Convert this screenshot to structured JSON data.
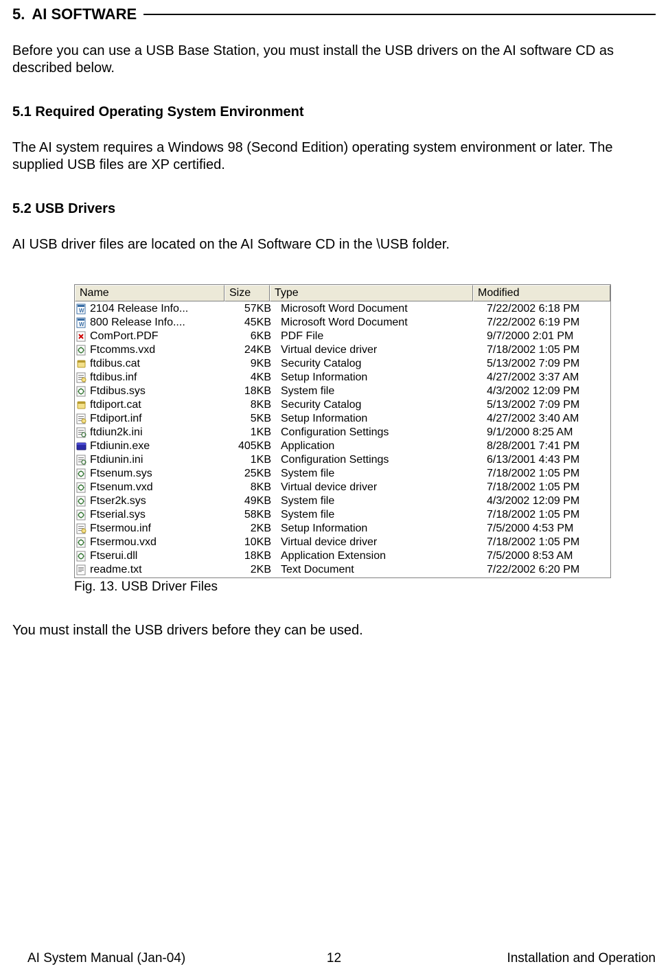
{
  "section": {
    "number": "5.",
    "title": "AI SOFTWARE",
    "intro": "Before you can use a USB Base Station, you must install the USB drivers on the AI software CD as described below."
  },
  "sub1": {
    "heading": "5.1  Required Operating System Environment",
    "text": "The AI system requires a Windows 98 (Second Edition) operating system environment or later.  The supplied USB files are XP certified."
  },
  "sub2": {
    "heading": "5.2  USB Drivers",
    "text1": "AI USB driver files are located on the AI Software CD in the \\USB folder.",
    "text2": "You must install the USB drivers before they can be used."
  },
  "figure": {
    "caption": "Fig. 13.  USB Driver Files",
    "headers": {
      "name": "Name",
      "size": "Size",
      "type": "Type",
      "modified": "Modified"
    },
    "rows": [
      {
        "icon": "word",
        "name": "2104 Release Info...",
        "size": "57KB",
        "type": "Microsoft Word Document",
        "modified": "7/22/2002 6:18 PM"
      },
      {
        "icon": "word",
        "name": "800 Release Info....",
        "size": "45KB",
        "type": "Microsoft Word Document",
        "modified": "7/22/2002 6:19 PM"
      },
      {
        "icon": "pdf",
        "name": "ComPort.PDF",
        "size": "6KB",
        "type": "PDF File",
        "modified": "9/7/2000 2:01 PM"
      },
      {
        "icon": "sys",
        "name": "Ftcomms.vxd",
        "size": "24KB",
        "type": "Virtual device driver",
        "modified": "7/18/2002 1:05 PM"
      },
      {
        "icon": "cat",
        "name": "ftdibus.cat",
        "size": "9KB",
        "type": "Security Catalog",
        "modified": "5/13/2002 7:09 PM"
      },
      {
        "icon": "inf",
        "name": "ftdibus.inf",
        "size": "4KB",
        "type": "Setup Information",
        "modified": "4/27/2002 3:37 AM"
      },
      {
        "icon": "sys",
        "name": "Ftdibus.sys",
        "size": "18KB",
        "type": "System file",
        "modified": "4/3/2002 12:09 PM"
      },
      {
        "icon": "cat",
        "name": "ftdiport.cat",
        "size": "8KB",
        "type": "Security Catalog",
        "modified": "5/13/2002 7:09 PM"
      },
      {
        "icon": "inf",
        "name": "Ftdiport.inf",
        "size": "5KB",
        "type": "Setup Information",
        "modified": "4/27/2002 3:40 AM"
      },
      {
        "icon": "ini",
        "name": "ftdiun2k.ini",
        "size": "1KB",
        "type": "Configuration Settings",
        "modified": "9/1/2000 8:25 AM"
      },
      {
        "icon": "exe",
        "name": "Ftdiunin.exe",
        "size": "405KB",
        "type": "Application",
        "modified": "8/28/2001 7:41 PM"
      },
      {
        "icon": "ini",
        "name": "Ftdiunin.ini",
        "size": "1KB",
        "type": "Configuration Settings",
        "modified": "6/13/2001 4:43 PM"
      },
      {
        "icon": "sys",
        "name": "Ftsenum.sys",
        "size": "25KB",
        "type": "System file",
        "modified": "7/18/2002 1:05 PM"
      },
      {
        "icon": "sys",
        "name": "Ftsenum.vxd",
        "size": "8KB",
        "type": "Virtual device driver",
        "modified": "7/18/2002 1:05 PM"
      },
      {
        "icon": "sys",
        "name": "Ftser2k.sys",
        "size": "49KB",
        "type": "System file",
        "modified": "4/3/2002 12:09 PM"
      },
      {
        "icon": "sys",
        "name": "Ftserial.sys",
        "size": "58KB",
        "type": "System file",
        "modified": "7/18/2002 1:05 PM"
      },
      {
        "icon": "inf",
        "name": "Ftsermou.inf",
        "size": "2KB",
        "type": "Setup Information",
        "modified": "7/5/2000 4:53 PM"
      },
      {
        "icon": "sys",
        "name": "Ftsermou.vxd",
        "size": "10KB",
        "type": "Virtual device driver",
        "modified": "7/18/2002 1:05 PM"
      },
      {
        "icon": "sys",
        "name": "Ftserui.dll",
        "size": "18KB",
        "type": "Application Extension",
        "modified": "7/5/2000 8:53 AM"
      },
      {
        "icon": "txt",
        "name": "readme.txt",
        "size": "2KB",
        "type": "Text Document",
        "modified": "7/22/2002 6:20 PM"
      }
    ]
  },
  "footer": {
    "left": "AI System Manual (Jan-04)",
    "page": "12",
    "right": "Installation and Operation"
  }
}
